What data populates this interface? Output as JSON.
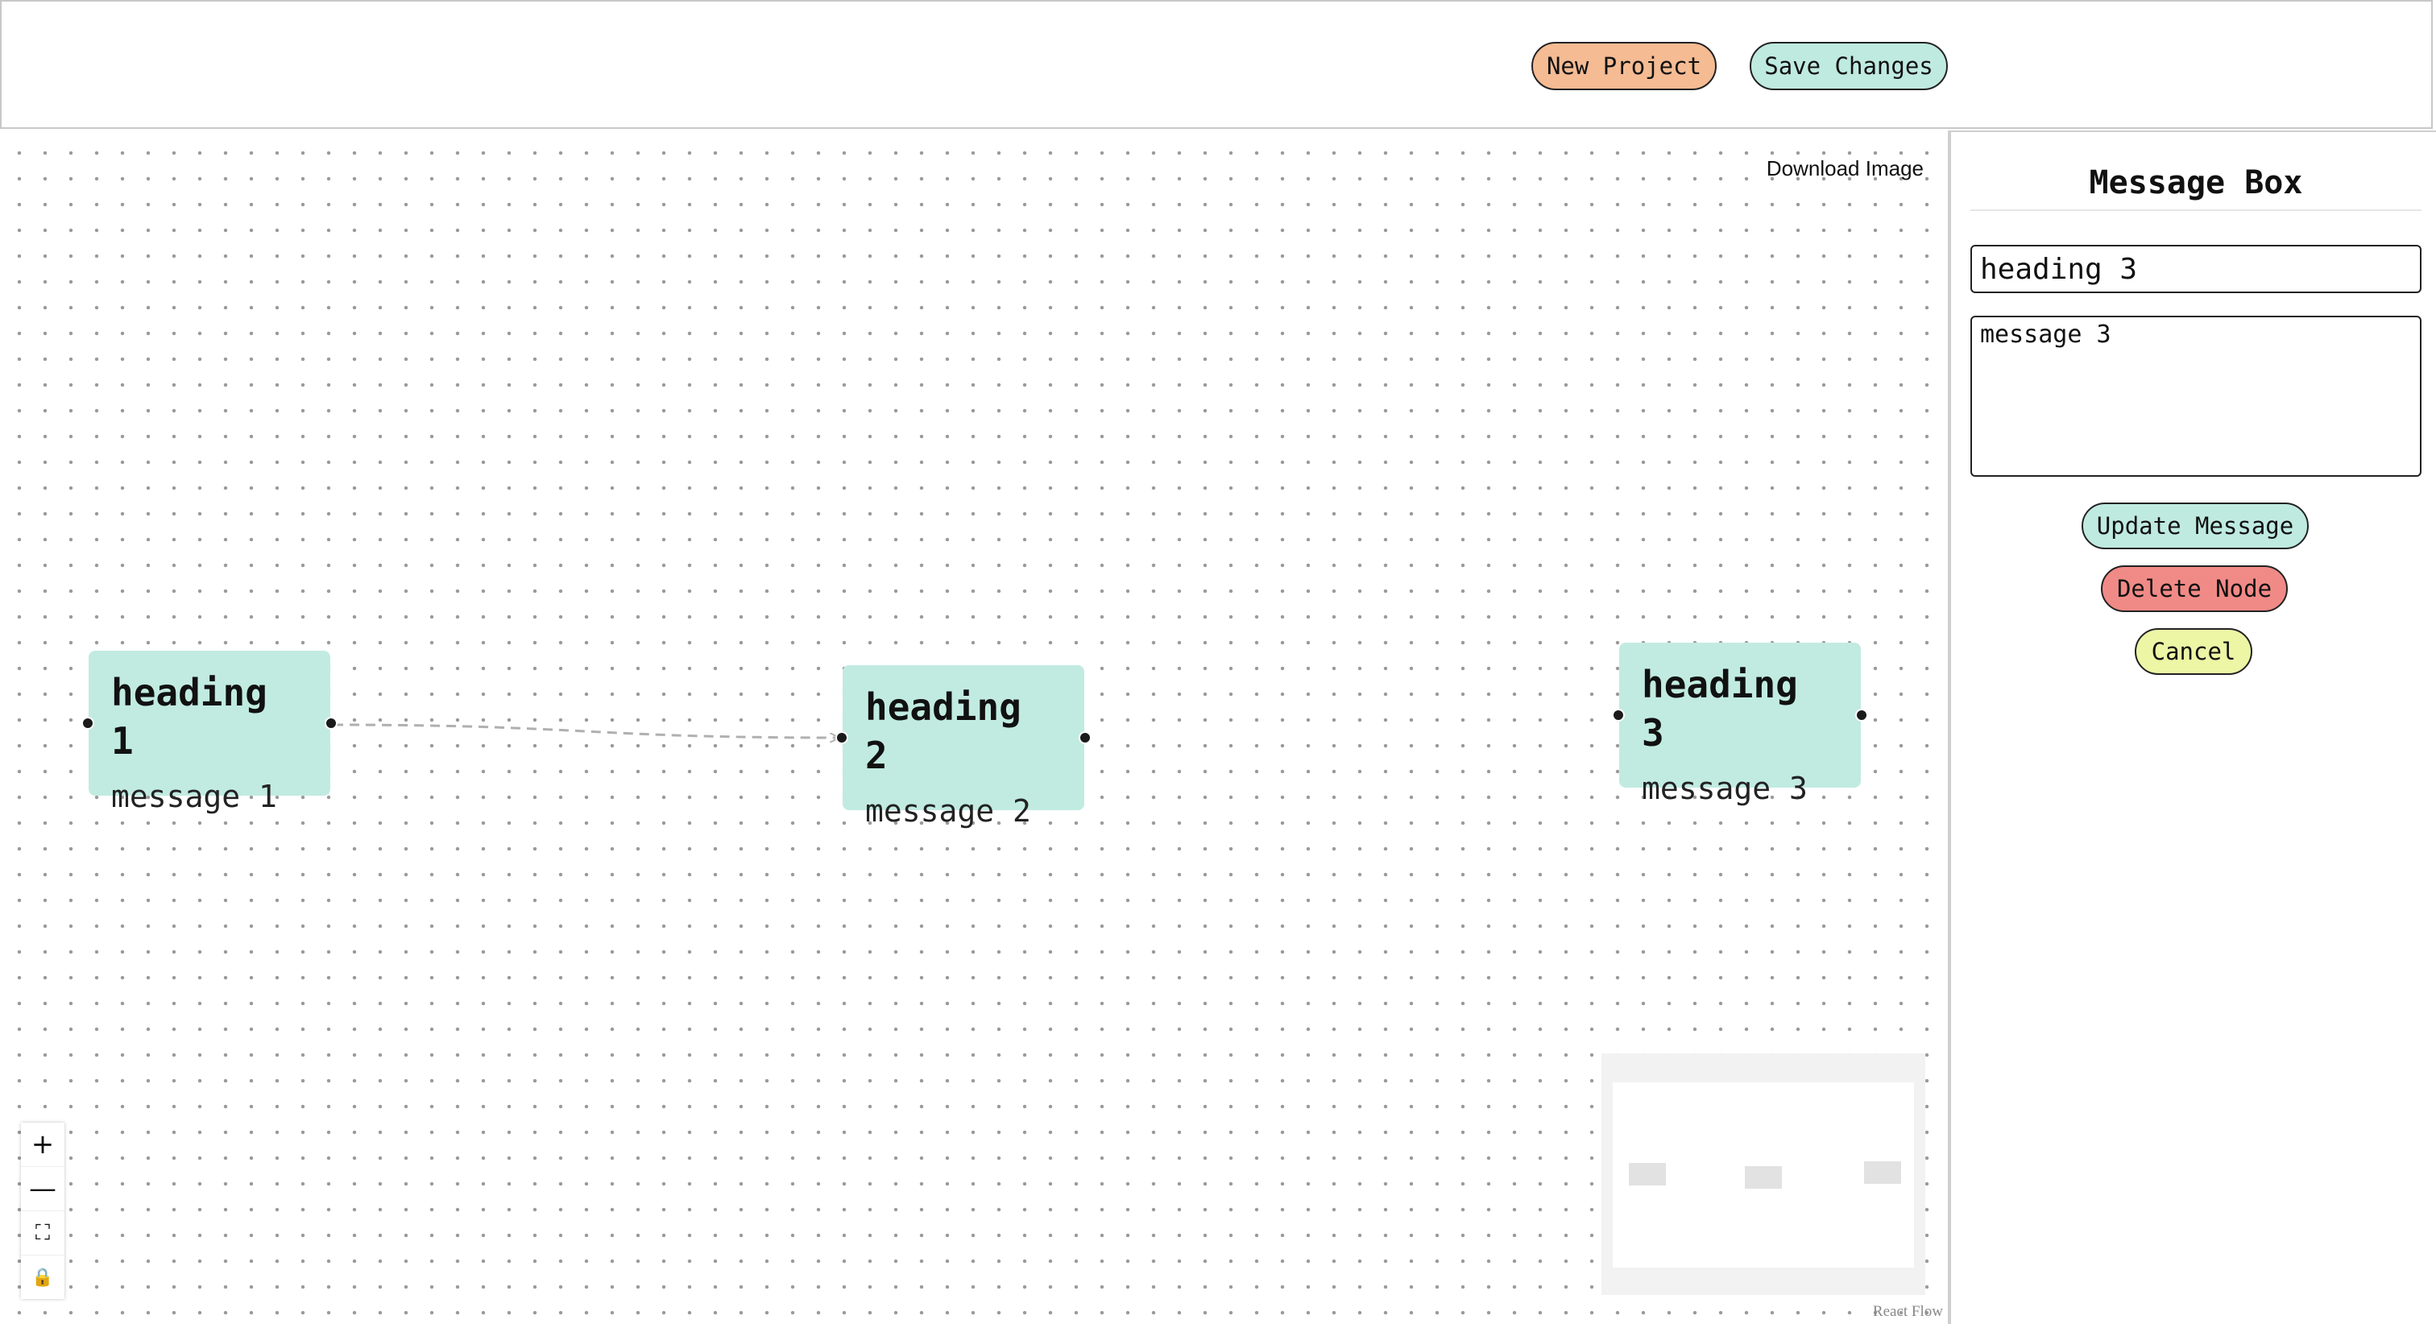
{
  "header": {
    "new_project_label": "New Project",
    "save_changes_label": "Save Changes",
    "new_project_color": "#f5bb93",
    "save_changes_color": "#bfeadf"
  },
  "canvas": {
    "download_label": "Download Image",
    "attribution": "React Flow",
    "nodes": [
      {
        "heading": "heading 1",
        "message": "message 1"
      },
      {
        "heading": "heading 2",
        "message": "message 2"
      },
      {
        "heading": "heading 3",
        "message": "message 3"
      }
    ],
    "node_color": "#c1ebe1",
    "controls": [
      {
        "icon": "plus-icon",
        "glyph": "+"
      },
      {
        "icon": "minus-icon",
        "glyph": "—"
      },
      {
        "icon": "fit-view-icon",
        "glyph": "⛶"
      },
      {
        "icon": "lock-icon",
        "glyph": "🔒"
      }
    ]
  },
  "sidebar": {
    "title": "Message Box",
    "heading_value": "heading 3",
    "message_value": "message 3",
    "update_label": "Update Message",
    "delete_label": "Delete Node",
    "cancel_label": "Cancel",
    "update_color": "#bfeadf",
    "delete_color": "#f08a86",
    "cancel_color": "#ecf6a5"
  }
}
